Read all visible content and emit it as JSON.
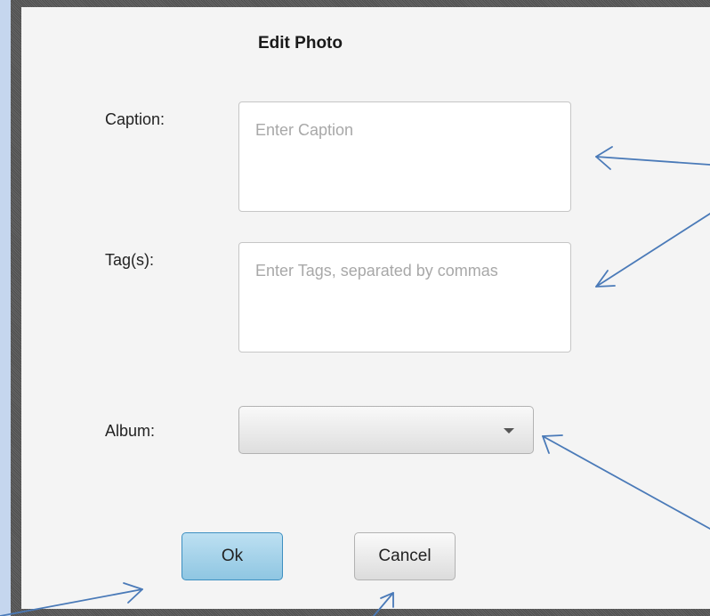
{
  "dialog": {
    "title": "Edit Photo",
    "caption": {
      "label": "Caption:",
      "placeholder": "Enter Caption"
    },
    "tags": {
      "label": "Tag(s):",
      "placeholder": "Enter Tags, separated by commas"
    },
    "album": {
      "label": "Album:",
      "selected": ""
    },
    "buttons": {
      "ok": "Ok",
      "cancel": "Cancel"
    }
  },
  "annotations": {
    "arrow_color": "#4a7ab8"
  },
  "colors": {
    "background": "#c5d6ee",
    "dialog_bg": "#f4f4f4",
    "ok_button": "#a6d3ea"
  }
}
